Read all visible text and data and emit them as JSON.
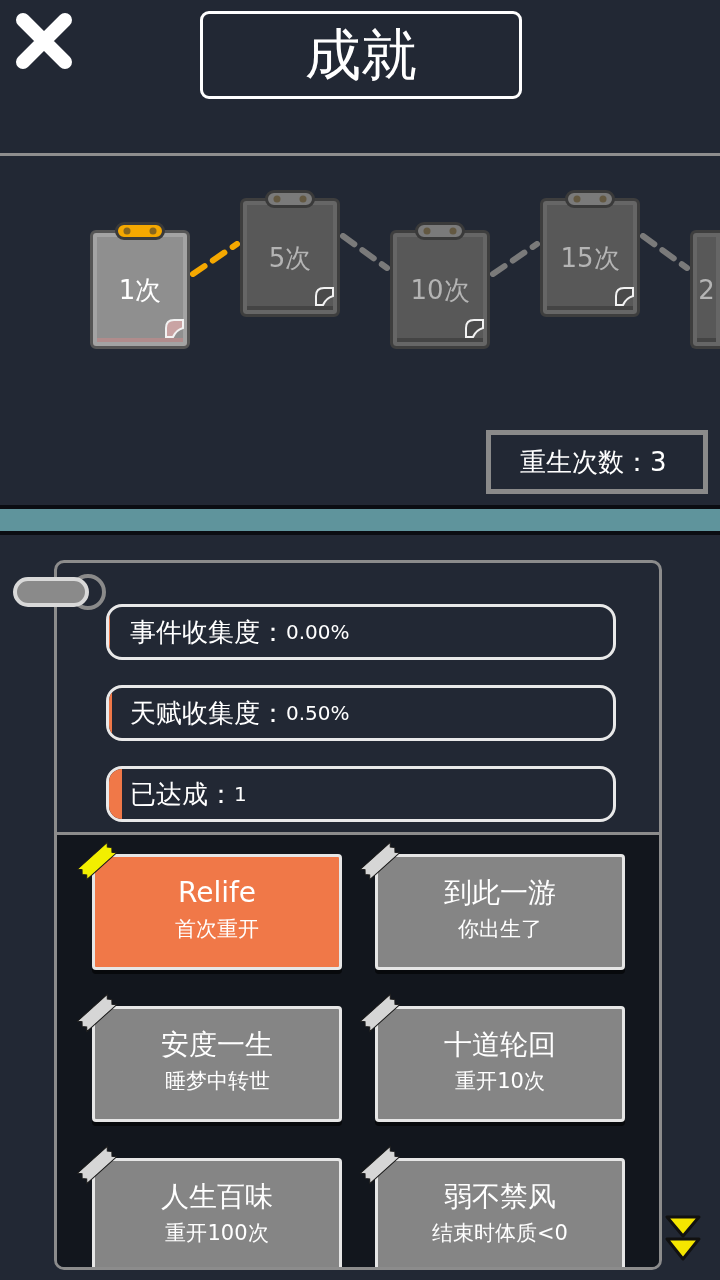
{
  "header": {
    "title": "成就"
  },
  "milestones": [
    {
      "label": "1次",
      "reached": true
    },
    {
      "label": "5次",
      "reached": false
    },
    {
      "label": "10次",
      "reached": false
    },
    {
      "label": "15次",
      "reached": false
    },
    {
      "label": "2",
      "reached": false
    }
  ],
  "rebirth_count": {
    "text": "重生次数：3"
  },
  "stats": [
    {
      "label": "事件收集度：",
      "value": "0.00%",
      "level": 0
    },
    {
      "label": "天赋收集度：",
      "value": "0.50%",
      "level": 0.005
    },
    {
      "label": "已达成：",
      "value": "1",
      "level": 0.025
    }
  ],
  "achievements": [
    {
      "title": "Relife",
      "description": "首次重开",
      "achieved": true
    },
    {
      "title": "到此一游",
      "description": "你出生了",
      "achieved": false
    },
    {
      "title": "安度一生",
      "description": "睡梦中转世",
      "achieved": false
    },
    {
      "title": "十道轮回",
      "description": "重开10次",
      "achieved": false
    },
    {
      "title": "人生百味",
      "description": "重开100次",
      "achieved": false
    },
    {
      "title": "弱不禁风",
      "description": "结束时体质<0",
      "achieved": false
    }
  ]
}
